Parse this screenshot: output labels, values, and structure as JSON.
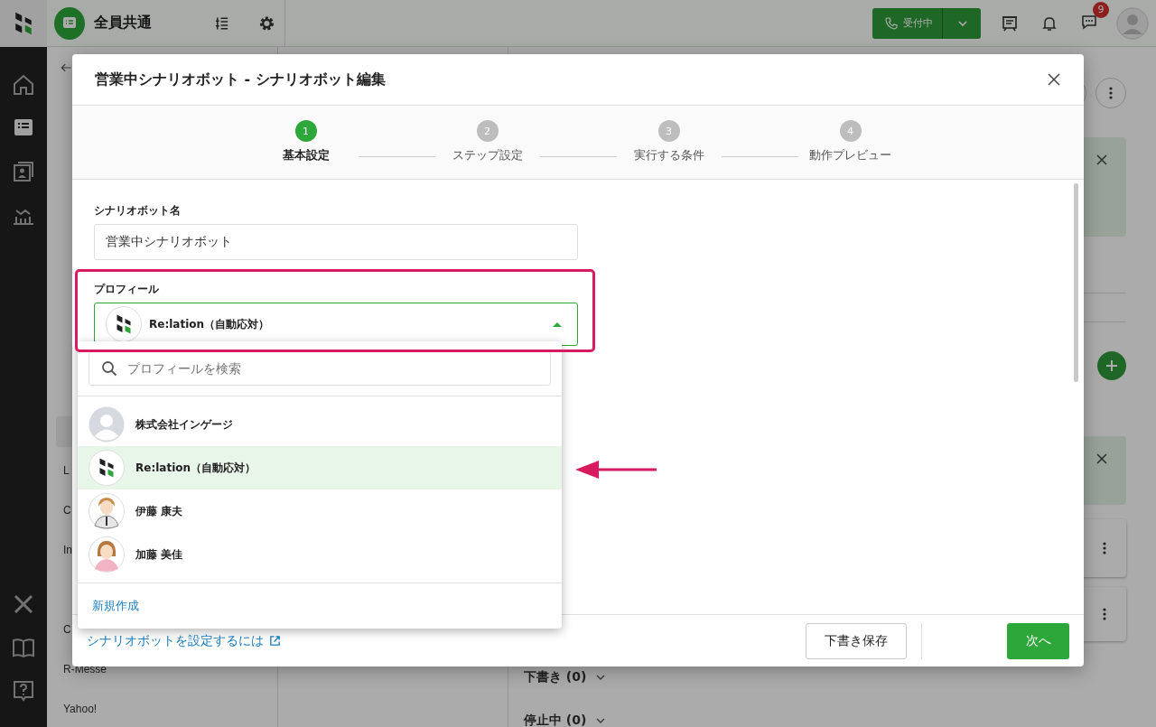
{
  "topbar": {
    "workspace": "全員共通",
    "status_button": "受付中",
    "badge": "9"
  },
  "side_panel": {
    "items": [
      {
        "selected": true
      },
      {
        "label": "L",
        "selected": false
      },
      {
        "label": "C",
        "selected": false
      },
      {
        "label": "In",
        "selected": false
      },
      {
        "selected": false
      },
      {
        "label": "C",
        "selected": false
      },
      {
        "label": "R-Messe",
        "selected": false
      },
      {
        "label": "Yahoo!",
        "selected": false
      }
    ]
  },
  "main": {
    "sections": [
      {
        "label": "下書き (0)",
        "expanded": false
      },
      {
        "label": "停止中 (0)",
        "expanded": false
      }
    ]
  },
  "modal": {
    "title": "営業中シナリオボット - シナリオボット編集",
    "steps": [
      {
        "number": "1",
        "label": "基本設定",
        "selected": true
      },
      {
        "number": "2",
        "label": "ステップ設定",
        "selected": false
      },
      {
        "number": "3",
        "label": "実行する条件",
        "selected": false
      },
      {
        "number": "4",
        "label": "動作プレビュー",
        "selected": false
      }
    ],
    "name_label": "シナリオボット名",
    "name_value": "営業中シナリオボット",
    "profile_label": "プロフィール",
    "profile_value": "Re:lation（自動応対）",
    "profile_open": true,
    "dropdown": {
      "search_placeholder": "プロフィールを検索",
      "options": [
        {
          "name": "株式会社インゲージ",
          "kind": "blank",
          "selected": false
        },
        {
          "name": "Re:lation（自動応対）",
          "kind": "logo",
          "selected": true
        },
        {
          "name": "伊藤 康夫",
          "kind": "male",
          "selected": false
        },
        {
          "name": "加藤 美佳",
          "kind": "female",
          "selected": false
        }
      ],
      "create_link": "新規作成"
    },
    "help_link": "シナリオボットを設定するには",
    "draft_button": "下書き保存",
    "next_button": "次へ"
  }
}
